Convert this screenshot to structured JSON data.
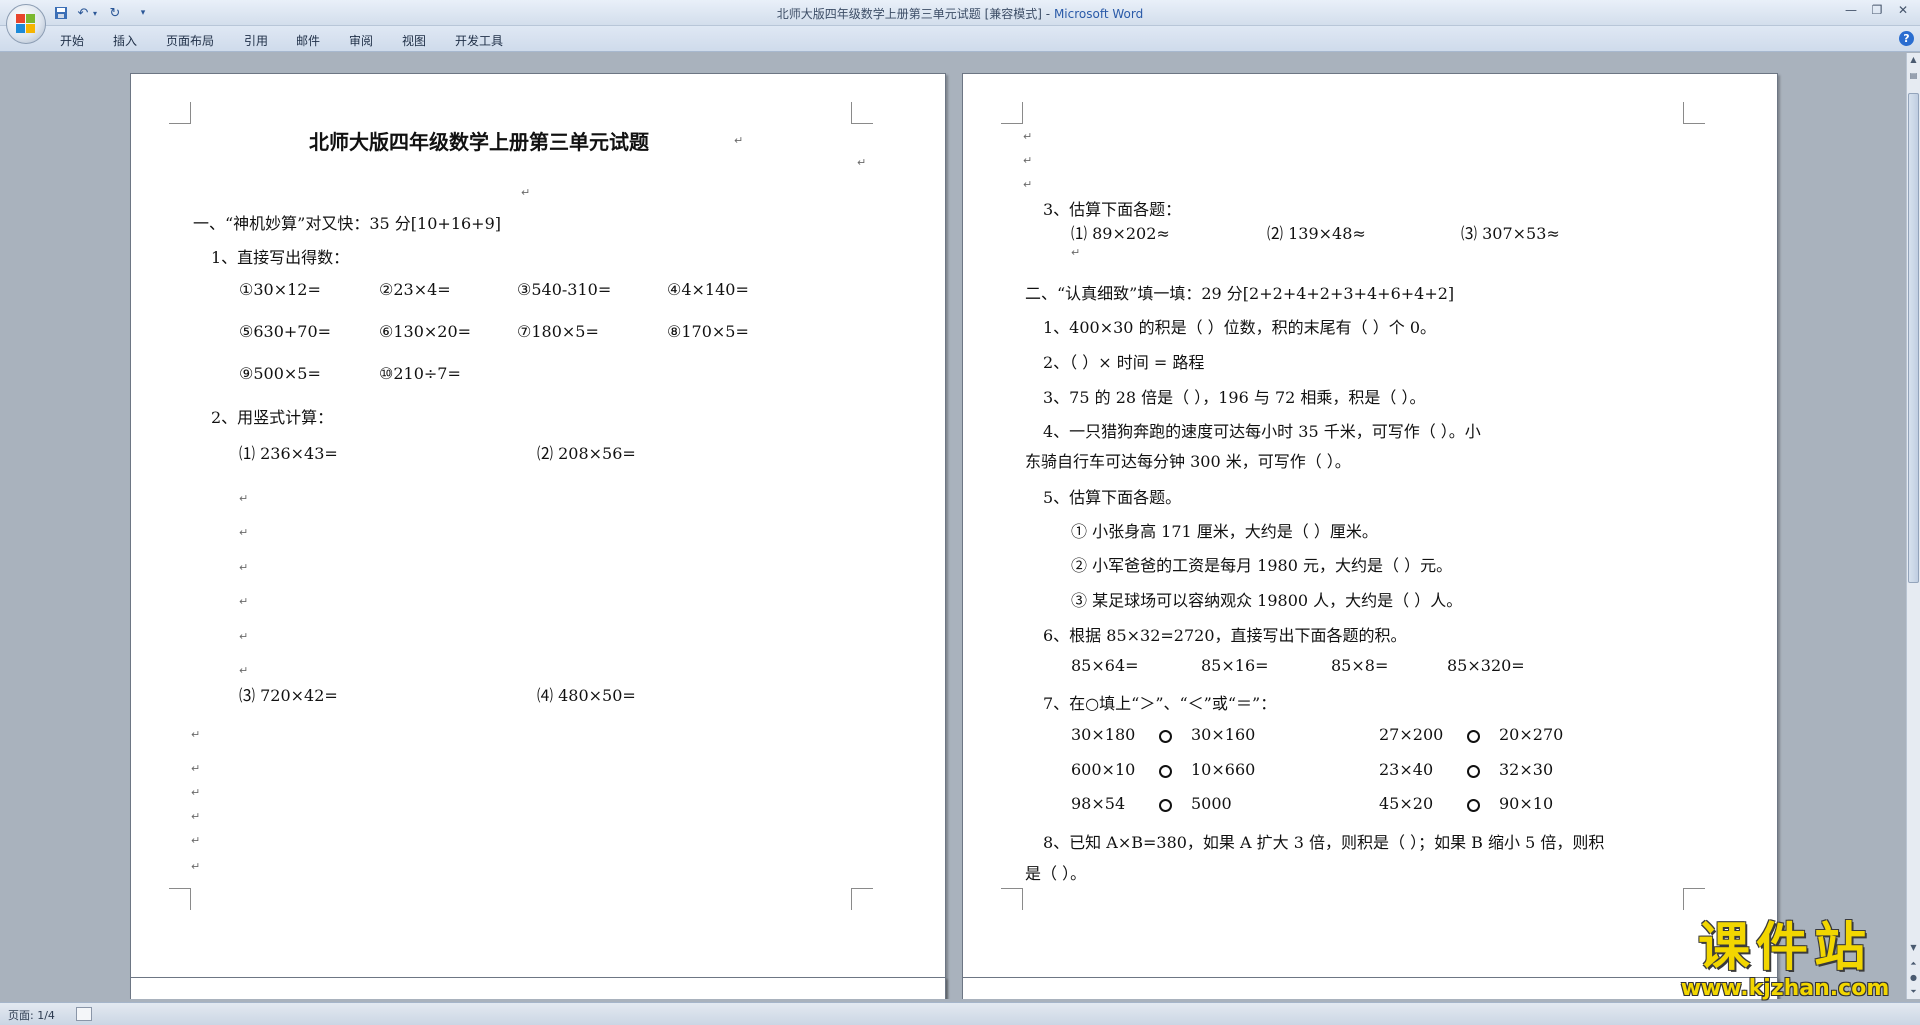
{
  "window": {
    "title": "北师大版四年级数学上册第三单元试题 [兼容模式]",
    "app_name": "Microsoft Word",
    "separator": " - "
  },
  "ribbon": {
    "tabs": [
      "开始",
      "插入",
      "页面布局",
      "引用",
      "邮件",
      "审阅",
      "视图",
      "开发工具"
    ],
    "help": "?"
  },
  "status_bar": {
    "page_info": "页面: 1/4"
  },
  "watermark": {
    "brand": "课件站",
    "url": "www.kjzhan.com"
  },
  "colors": {
    "workspace": "#a9b2bd",
    "watermark": "#f2d600"
  },
  "page1": {
    "title": "北师大版四年级数学上册第三单元试题",
    "section1": "一、“神机妙算”对又快：35 分[10+16+9]",
    "q1": "1、直接写出得数：",
    "q1_items": [
      "①30×12=",
      "②23×4=",
      "③540-310=",
      "④4×140=",
      "⑤630+70=",
      "⑥130×20=",
      "⑦180×5=",
      "⑧170×5=",
      "⑨500×5=",
      "⑩210÷7="
    ],
    "q2": "2、用竖式计算：",
    "q2_items": [
      "⑴ 236×43=",
      "⑵ 208×56=",
      "⑶ 720×42=",
      "⑷ 480×50="
    ]
  },
  "page2": {
    "q3": "3、估算下面各题：",
    "q3_items": [
      "⑴ 89×202≈",
      "⑵ 139×48≈",
      "⑶ 307×53≈"
    ],
    "section2": "二、“认真细致”填一填：29 分[2+2+4+2+3+4+6+4+2]",
    "f1": "1、400×30 的积是（       ）位数，积的末尾有（     ）个 0。",
    "f2": "2、（          ）× 时间 = 路程",
    "f3": "3、75 的 28 倍是（         ），196 与 72 相乘，积是（         ）。",
    "f4_line1": "4、一只猎狗奔跑的速度可达每小时 35 千米，可写作（                    ）。小",
    "f4_line2": "东骑自行车可达每分钟 300 米，可写作（                    ）。",
    "f5": "5、估算下面各题。",
    "f5_items": [
      "① 小张身高 171 厘米，大约是（        ）厘米。",
      "② 小军爸爸的工资是每月 1980 元，大约是（         ）元。",
      "③ 某足球场可以容纳观众 19800 人，大约是（         ）人。"
    ],
    "f6": "6、根据 85×32=2720，直接写出下面各题的积。",
    "f6_items": [
      "85×64=",
      "85×16=",
      "85×8=",
      "85×320="
    ],
    "f7": "7、在○填上“＞”、“＜”或“＝”：",
    "f7_rows": [
      {
        "a": "30×180",
        "b": "30×160",
        "c": "27×200",
        "d": "20×270"
      },
      {
        "a": "600×10",
        "b": "10×660",
        "c": "23×40",
        "d": "32×30"
      },
      {
        "a": "98×54",
        "b": "5000",
        "c": "45×20",
        "d": "90×10"
      }
    ],
    "f8_line1": "8、已知 A×B=380，如果 A 扩大 3 倍，则积是（     ）；如果 B 缩小 5 倍，则积",
    "f8_line2": "是（       ）。"
  },
  "pilcrow": "↵"
}
